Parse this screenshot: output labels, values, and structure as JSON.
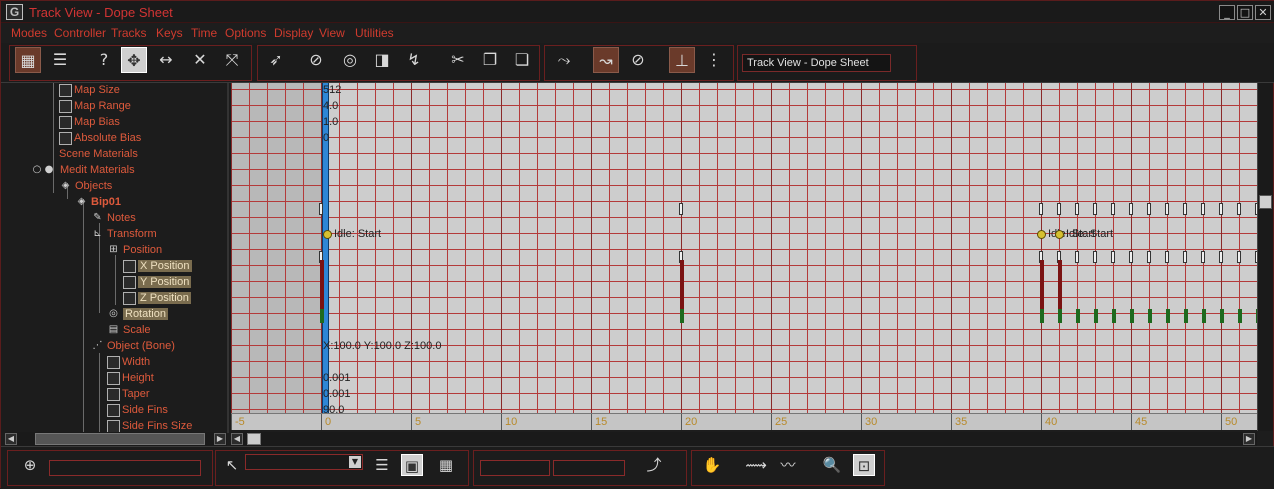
{
  "window": {
    "title": "Track View - Dope Sheet",
    "app_icon_glyph": "G",
    "minimize_glyph": "_",
    "maximize_glyph": "□",
    "close_glyph": "✕"
  },
  "menu": [
    "Modes",
    "Controller",
    "Tracks",
    "Keys",
    "Time",
    "Options",
    "Display",
    "View",
    "Utilities"
  ],
  "toolbar": {
    "view_name": "Track View - Dope Sheet",
    "buttons": [
      {
        "name": "edit-keys-icon",
        "glyph": "▦",
        "active": true
      },
      {
        "name": "edit-ranges-icon",
        "glyph": "☰",
        "active": false
      },
      {
        "name": "filters-icon",
        "glyph": "?",
        "active": false
      },
      {
        "name": "move-keys-icon",
        "glyph": "✥",
        "pressed": true
      },
      {
        "name": "slide-keys-icon",
        "glyph": "↔",
        "active": false
      },
      {
        "name": "add-keys-icon",
        "glyph": "✕",
        "active": false
      },
      {
        "name": "scale-keys-icon",
        "glyph": "⤧",
        "active": false
      },
      {
        "name": "select-keys-icon",
        "glyph": "➶",
        "active": false
      },
      {
        "name": "insert-time-icon",
        "glyph": "⊘",
        "active": false
      },
      {
        "name": "cycle-icon",
        "glyph": "◎",
        "active": false
      },
      {
        "name": "reverse-time-icon",
        "glyph": "◨",
        "active": false
      },
      {
        "name": "select-time-icon",
        "glyph": "↯",
        "active": false
      },
      {
        "name": "cut-icon",
        "glyph": "✂",
        "active": false
      },
      {
        "name": "copy-icon",
        "glyph": "❐",
        "active": false
      },
      {
        "name": "paste-icon",
        "glyph": "❏",
        "active": false
      },
      {
        "name": "modify-subtree-icon",
        "glyph": "⤳",
        "active": false
      },
      {
        "name": "snap-frames-icon",
        "glyph": "↝",
        "active": true
      },
      {
        "name": "lock-selection-icon",
        "glyph": "⊘",
        "active": false
      },
      {
        "name": "hierarchy-icon",
        "glyph": "⊥",
        "active": true
      },
      {
        "name": "show-tangents-icon",
        "glyph": "⋮",
        "active": false
      }
    ]
  },
  "tree": {
    "items": [
      {
        "label": "Map Size",
        "type": "box",
        "indent": 58
      },
      {
        "label": "Map Range",
        "type": "box",
        "indent": 58
      },
      {
        "label": "Map Bias",
        "type": "box",
        "indent": 58
      },
      {
        "label": "Absolute Bias",
        "type": "box",
        "indent": 58
      },
      {
        "label": "Scene Materials",
        "type": "none",
        "indent": 58
      },
      {
        "label": "Medit Materials",
        "type": "spheres",
        "indent": 28
      },
      {
        "label": "Objects",
        "type": "cube",
        "indent": 58
      },
      {
        "label": "Bip01",
        "type": "cube-bold",
        "indent": 74
      },
      {
        "label": "Notes",
        "type": "note",
        "indent": 90
      },
      {
        "label": "Transform",
        "type": "transform",
        "indent": 90
      },
      {
        "label": "Position",
        "type": "position",
        "indent": 106
      },
      {
        "label": "X Position",
        "type": "box-sel",
        "indent": 122
      },
      {
        "label": "Y Position",
        "type": "box-sel",
        "indent": 122
      },
      {
        "label": "Z Position",
        "type": "box-sel",
        "indent": 122
      },
      {
        "label": "Rotation",
        "type": "rotation-sel",
        "indent": 106
      },
      {
        "label": "Scale",
        "type": "scale",
        "indent": 106
      },
      {
        "label": "Object (Bone)",
        "type": "bone",
        "indent": 90
      },
      {
        "label": "Width",
        "type": "box",
        "indent": 106
      },
      {
        "label": "Height",
        "type": "box",
        "indent": 106
      },
      {
        "label": "Taper",
        "type": "box",
        "indent": 106
      },
      {
        "label": "Side Fins",
        "type": "box",
        "indent": 106
      },
      {
        "label": "Side Fins Size",
        "type": "box",
        "indent": 106
      }
    ]
  },
  "grid": {
    "cell_values": [
      "512",
      "4.0",
      "1.0",
      "0",
      "",
      "",
      "",
      "",
      "",
      "Idle: Start",
      "",
      "",
      "",
      "",
      "",
      "",
      "X:100.0 Y:100.0 Z:100.0",
      "",
      "0.001",
      "0.001",
      "90.0",
      "0"
    ],
    "note_label_2": "Idle: Start",
    "note_label_3": "Idle: Start",
    "frame_start": -5,
    "frame_end": 52,
    "ruler_ticks": [
      "-5",
      "0",
      "5",
      "10",
      "15",
      "20",
      "25",
      "30",
      "35",
      "40",
      "45",
      "50",
      "5"
    ]
  },
  "status": {
    "field_1_value": "",
    "dropdown_value": "",
    "field_2_value": "",
    "field_3_value": "",
    "buttons": [
      {
        "name": "zoom-selected-icon",
        "glyph": "⊕"
      },
      {
        "name": "select-object-icon",
        "glyph": "↖"
      },
      {
        "name": "list-view-icon",
        "glyph": "☰"
      },
      {
        "name": "keys-view-icon",
        "glyph": "▣",
        "pressed": true
      },
      {
        "name": "grid-view-icon",
        "glyph": "▦"
      },
      {
        "name": "curve-icon",
        "glyph": "⤴"
      },
      {
        "name": "pan-icon",
        "glyph": "✋"
      },
      {
        "name": "zoom-horizontal-icon",
        "glyph": "⟿"
      },
      {
        "name": "zoom-value-icon",
        "glyph": "〰"
      },
      {
        "name": "zoom-icon",
        "glyph": "🔍"
      },
      {
        "name": "zoom-region-icon",
        "glyph": "⊡",
        "pressed": true
      }
    ]
  }
}
